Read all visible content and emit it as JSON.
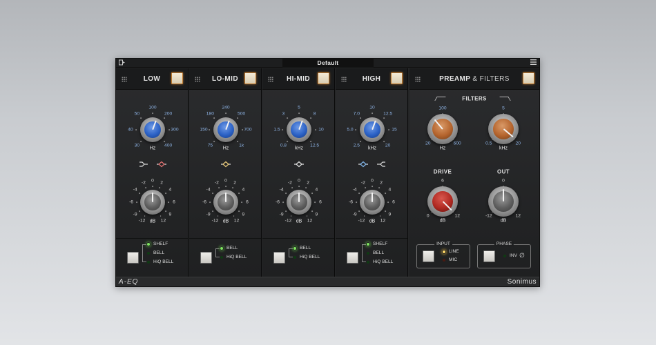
{
  "window": {
    "preset_name": "Default",
    "left_icon": "preset-browser-icon",
    "right_icon": "hamburger-menu-icon"
  },
  "bands": [
    {
      "id": "low",
      "title": "LOW",
      "freq": {
        "ticks": [
          "100",
          "200",
          "300",
          "400",
          "30",
          "40",
          "50"
        ],
        "unit": "Hz",
        "color": "#2c62c6"
      },
      "gain": {
        "ticks": [
          "0",
          "2",
          "4",
          "6",
          "9",
          "12",
          "-12",
          "-9",
          "-6",
          "-4",
          "-2"
        ],
        "unit": "dB"
      },
      "shape_icons": [
        "low-shelf-shape-icon",
        "low-bell-shape-icon"
      ],
      "options": [
        "SHELF",
        "BELL",
        "HiQ BELL"
      ],
      "selected": 0
    },
    {
      "id": "lo-mid",
      "title": "LO-MID",
      "freq": {
        "ticks": [
          "240",
          "500",
          "700",
          "1k",
          "75",
          "150",
          "180"
        ],
        "unit": "Hz",
        "color": "#2c62c6"
      },
      "gain": {
        "ticks": [
          "0",
          "2",
          "4",
          "6",
          "9",
          "12",
          "-12",
          "-9",
          "-6",
          "-4",
          "-2"
        ],
        "unit": "dB"
      },
      "shape_icons": [
        "lo-mid-bell-shape-icon"
      ],
      "options": [
        "BELL",
        "HiQ BELL"
      ],
      "selected": 0
    },
    {
      "id": "hi-mid",
      "title": "HI-MID",
      "freq": {
        "ticks": [
          "5",
          "8",
          "10",
          "12.5",
          "0.8",
          "1.5",
          "3"
        ],
        "unit": "kHz",
        "color": "#2c62c6"
      },
      "gain": {
        "ticks": [
          "0",
          "2",
          "4",
          "6",
          "9",
          "12",
          "-12",
          "-9",
          "-6",
          "-4",
          "-2"
        ],
        "unit": "dB"
      },
      "shape_icons": [
        "hi-mid-bell-shape-icon"
      ],
      "options": [
        "BELL",
        "HiQ BELL"
      ],
      "selected": 0
    },
    {
      "id": "high",
      "title": "HIGH",
      "freq": {
        "ticks": [
          "10",
          "12.5",
          "15",
          "20",
          "2.5",
          "5.0",
          "7.0"
        ],
        "unit": "kHz",
        "color": "#2c62c6"
      },
      "gain": {
        "ticks": [
          "0",
          "2",
          "4",
          "6",
          "9",
          "12",
          "-12",
          "-9",
          "-6",
          "-4",
          "-2"
        ],
        "unit": "dB"
      },
      "shape_icons": [
        "high-bell-shape-icon",
        "high-shelf-shape-icon"
      ],
      "options": [
        "SHELF",
        "BELL",
        "HiQ BELL"
      ],
      "selected": 0
    }
  ],
  "preamp": {
    "title_bold": "PREAMP",
    "title_rest": "& FILTERS",
    "filters_label": "FILTERS",
    "hpf": {
      "ticks": [
        "100",
        "20",
        "600"
      ],
      "unit": "Hz",
      "color": "#b5652e"
    },
    "lpf": {
      "ticks": [
        "5",
        "0.5",
        "20"
      ],
      "unit": "kHz",
      "color": "#b5652e"
    },
    "drive": {
      "label": "DRIVE",
      "ticks": [
        "6",
        "0",
        "12"
      ],
      "unit": "dB",
      "color": "#b02a22"
    },
    "out": {
      "label": "OUT",
      "ticks": [
        "0",
        "-12",
        "12"
      ],
      "unit": "dB"
    },
    "input": {
      "title": "INPUT",
      "options": [
        "LINE",
        "MIC"
      ],
      "selected": 0
    },
    "phase": {
      "title": "PHASE",
      "option": "INV",
      "symbol": "∅"
    }
  },
  "footer": {
    "product": "A-EQ",
    "brand": "Sonimus"
  }
}
